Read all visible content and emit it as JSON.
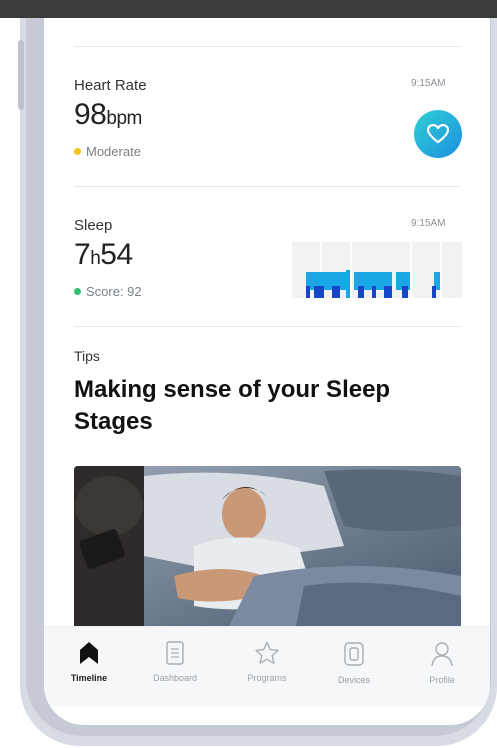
{
  "colors": {
    "accent_cyan": "#2fd0d3",
    "accent_blue": "#1b8fe0",
    "moderate_dot": "#f5c518",
    "score_dot": "#2fbf71",
    "sleep_bar_light": "#1aa7e6",
    "sleep_bar_dark": "#1546c9"
  },
  "heart_rate": {
    "label": "Heart Rate",
    "time": "9:15AM",
    "value": "98",
    "unit": "bpm",
    "status": "Moderate",
    "icon": "heart-icon"
  },
  "sleep": {
    "label": "Sleep",
    "time": "9:15AM",
    "hours": "7",
    "hours_unit": "h",
    "minutes": "54",
    "score": "Score: 92"
  },
  "tips": {
    "label": "Tips",
    "title": "Making sense of your Sleep Stages",
    "image": "sleeping-man-photo"
  },
  "tabbar": {
    "items": [
      {
        "label": "Timeline",
        "icon": "timeline-icon",
        "active": true
      },
      {
        "label": "Dashboard",
        "icon": "dashboard-icon",
        "active": false
      },
      {
        "label": "Programs",
        "icon": "star-icon",
        "active": false
      },
      {
        "label": "Devices",
        "icon": "watch-icon",
        "active": false
      },
      {
        "label": "Profile",
        "icon": "profile-icon",
        "active": false
      }
    ]
  }
}
